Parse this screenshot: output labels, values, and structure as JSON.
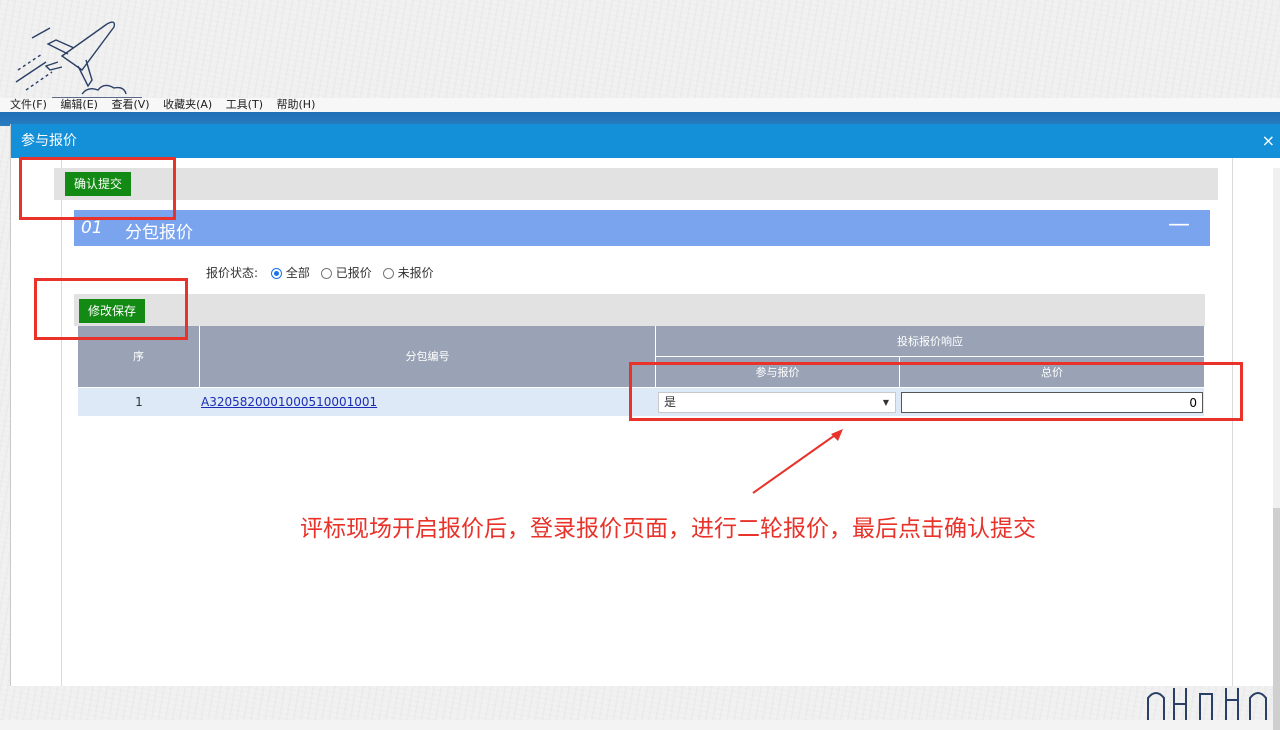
{
  "menubar": [
    "文件(F)",
    "编辑(E)",
    "查看(V)",
    "收藏夹(A)",
    "工具(T)",
    "帮助(H)"
  ],
  "dialog": {
    "title": "参与报价",
    "close": "×"
  },
  "toolbar": {
    "confirm_label": "确认提交",
    "save_label": "修改保存"
  },
  "section": {
    "num": "01",
    "title": "分包报价",
    "collapse": "—"
  },
  "filter": {
    "label": "报价状态:",
    "options": [
      "全部",
      "已报价",
      "未报价"
    ],
    "selected": "全部"
  },
  "table": {
    "headers": {
      "seq": "序",
      "package_no": "分包编号",
      "group": "投标报价响应",
      "participate": "参与报价",
      "total": "总价"
    },
    "rows": [
      {
        "seq": "1",
        "package_no": "A320582000100051000100‌1",
        "participate": "是",
        "total": "0"
      }
    ]
  },
  "annotation": "评标现场开启报价后，登录报价页面，进行二轮报价，最后点击确认提交",
  "colors": {
    "accent": "#1390d8",
    "section": "#7ba4ef",
    "button": "#138a13",
    "annotation": "#e8322a"
  }
}
